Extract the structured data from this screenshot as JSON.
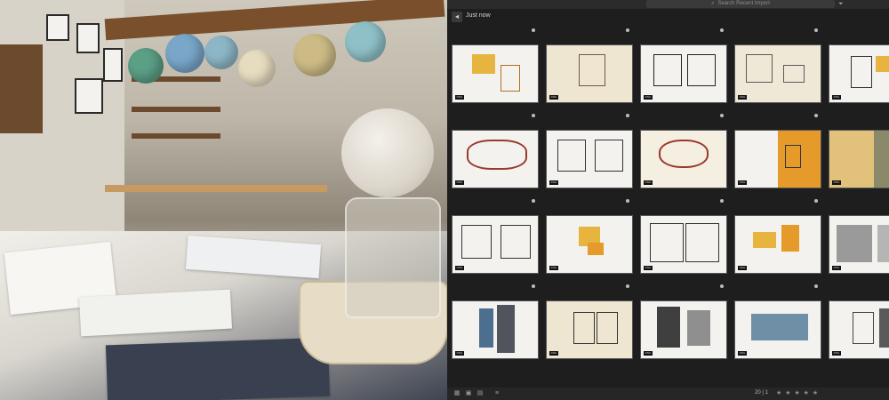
{
  "toolbar": {
    "search_placeholder": "Search Recent Import",
    "search_icon": "magnifier-icon",
    "filter_icon": "funnel-icon"
  },
  "header": {
    "title": "Just now",
    "back_icon": "back-icon"
  },
  "grid": {
    "rows": 4,
    "columns": 5,
    "badge": "DNG"
  },
  "bottom_bar": {
    "view_icons": [
      "grid-view-icon",
      "square-view-icon",
      "detail-view-icon"
    ],
    "sort_icon": "sort-icon",
    "count": "20 | 1",
    "stars": "★ ★ ★ ★ ★"
  },
  "colors": {
    "app_bg": "#1e1e1e",
    "accent_yellow": "#e7b53f",
    "accent_orange": "#e59a2a"
  }
}
